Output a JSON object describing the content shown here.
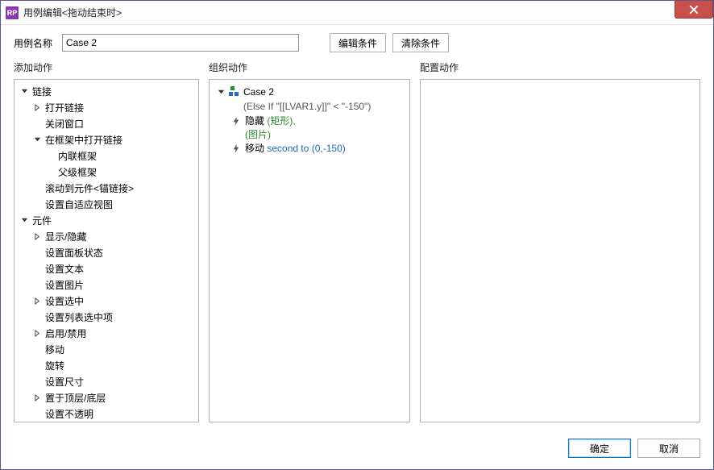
{
  "window": {
    "title": "用例编辑<拖动结束时>",
    "iconText": "RP"
  },
  "toprow": {
    "name_label": "用例名称",
    "case_name": "Case 2",
    "edit_condition": "编辑条件",
    "clear_condition": "清除条件"
  },
  "col_heads": {
    "add": "添加动作",
    "org": "组织动作",
    "cfg": "配置动作"
  },
  "tree": [
    {
      "lvl": 0,
      "exp": "open",
      "label": "链接"
    },
    {
      "lvl": 1,
      "exp": "closed",
      "label": "打开链接"
    },
    {
      "lvl": 1,
      "exp": "none",
      "label": "关闭窗口"
    },
    {
      "lvl": 1,
      "exp": "open",
      "label": "在框架中打开链接"
    },
    {
      "lvl": 2,
      "exp": "none",
      "label": "内联框架"
    },
    {
      "lvl": 2,
      "exp": "none",
      "label": "父级框架"
    },
    {
      "lvl": 1,
      "exp": "none",
      "label": "滚动到元件<锚链接>"
    },
    {
      "lvl": 1,
      "exp": "none",
      "label": "设置自适应视图"
    },
    {
      "lvl": 0,
      "exp": "open",
      "label": "元件"
    },
    {
      "lvl": 1,
      "exp": "closed",
      "label": "显示/隐藏"
    },
    {
      "lvl": 1,
      "exp": "none",
      "label": "设置面板状态"
    },
    {
      "lvl": 1,
      "exp": "none",
      "label": "设置文本"
    },
    {
      "lvl": 1,
      "exp": "none",
      "label": "设置图片"
    },
    {
      "lvl": 1,
      "exp": "closed",
      "label": "设置选中"
    },
    {
      "lvl": 1,
      "exp": "none",
      "label": "设置列表选中项"
    },
    {
      "lvl": 1,
      "exp": "closed",
      "label": "启用/禁用"
    },
    {
      "lvl": 1,
      "exp": "none",
      "label": "移动"
    },
    {
      "lvl": 1,
      "exp": "none",
      "label": "旋转"
    },
    {
      "lvl": 1,
      "exp": "none",
      "label": "设置尺寸"
    },
    {
      "lvl": 1,
      "exp": "closed",
      "label": "置于顶层/底层"
    },
    {
      "lvl": 1,
      "exp": "none",
      "label": "设置不透明"
    }
  ],
  "org": {
    "case_label": "Case 2",
    "condition": "(Else If \"[[LVAR1.y]]\" < \"-150\")",
    "actions": [
      {
        "verb": "隐藏",
        "arg1": "(矩形)",
        "arg1_color": "green",
        "line2": "(图片)",
        "line2_color": "green"
      },
      {
        "verb": "移动",
        "arg1": "second to (0,-150)",
        "arg1_color": "blue"
      }
    ]
  },
  "footer": {
    "ok": "确定",
    "cancel": "取消"
  }
}
